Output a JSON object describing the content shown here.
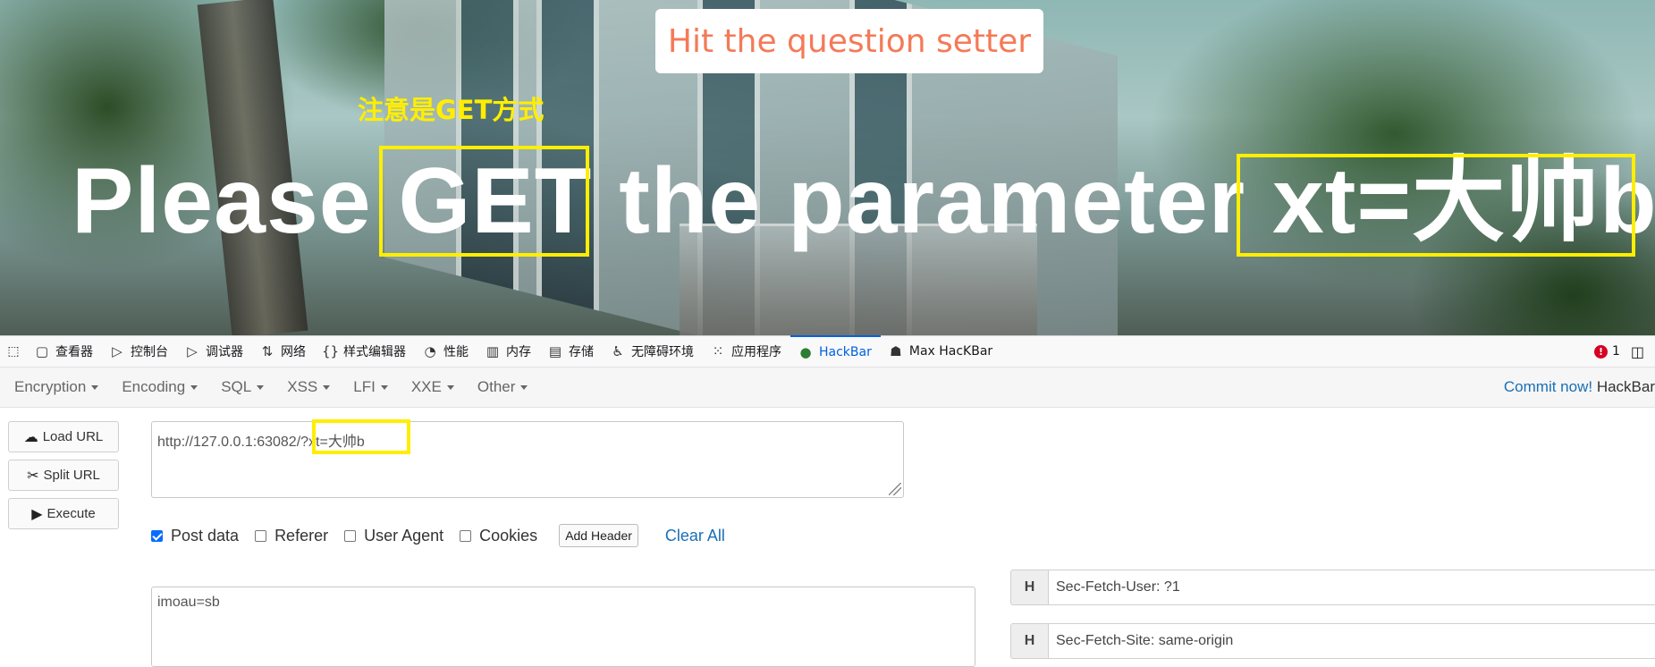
{
  "hero": {
    "question_button": "Hit the question setter",
    "hint": "注意是GET方式",
    "headline": {
      "part1": "Please ",
      "get": "GET",
      "part2": " the parameter ",
      "param": "xt=大帅b"
    }
  },
  "devtools": {
    "tabs": [
      {
        "label": "查看器",
        "icon": "inspector-icon"
      },
      {
        "label": "控制台",
        "icon": "console-icon"
      },
      {
        "label": "调试器",
        "icon": "debugger-icon"
      },
      {
        "label": "网络",
        "icon": "network-icon"
      },
      {
        "label": "样式编辑器",
        "icon": "style-editor-icon"
      },
      {
        "label": "性能",
        "icon": "performance-icon"
      },
      {
        "label": "内存",
        "icon": "memory-icon"
      },
      {
        "label": "存储",
        "icon": "storage-icon"
      },
      {
        "label": "无障碍环境",
        "icon": "accessibility-icon"
      },
      {
        "label": "应用程序",
        "icon": "application-icon"
      },
      {
        "label": "HackBar",
        "icon": "hackbar-icon",
        "active": true
      },
      {
        "label": "Max HacKBar",
        "icon": "max-hackbar-icon"
      }
    ],
    "error_count": "1",
    "accent_color": "#0061e0"
  },
  "hackbar": {
    "menu": [
      "Encryption",
      "Encoding",
      "SQL",
      "XSS",
      "LFI",
      "XXE",
      "Other"
    ],
    "commit_link": "Commit now!",
    "brand": "HackBar",
    "buttons": {
      "load_url": "Load URL",
      "split_url": "Split URL",
      "execute": "Execute"
    },
    "url_value": "http://127.0.0.1:63082/?xt=大帅b",
    "options": {
      "post_data": "Post data",
      "referer": "Referer",
      "user_agent": "User Agent",
      "cookies": "Cookies",
      "post_data_checked": true
    },
    "add_header": "Add Header",
    "clear_all": "Clear All",
    "post_body": "imoau=sb",
    "headers": [
      {
        "h": "H",
        "value": "Sec-Fetch-User: ?1"
      },
      {
        "h": "H",
        "value": "Sec-Fetch-Site: same-origin"
      }
    ],
    "highlight_color": "#ffee00"
  }
}
